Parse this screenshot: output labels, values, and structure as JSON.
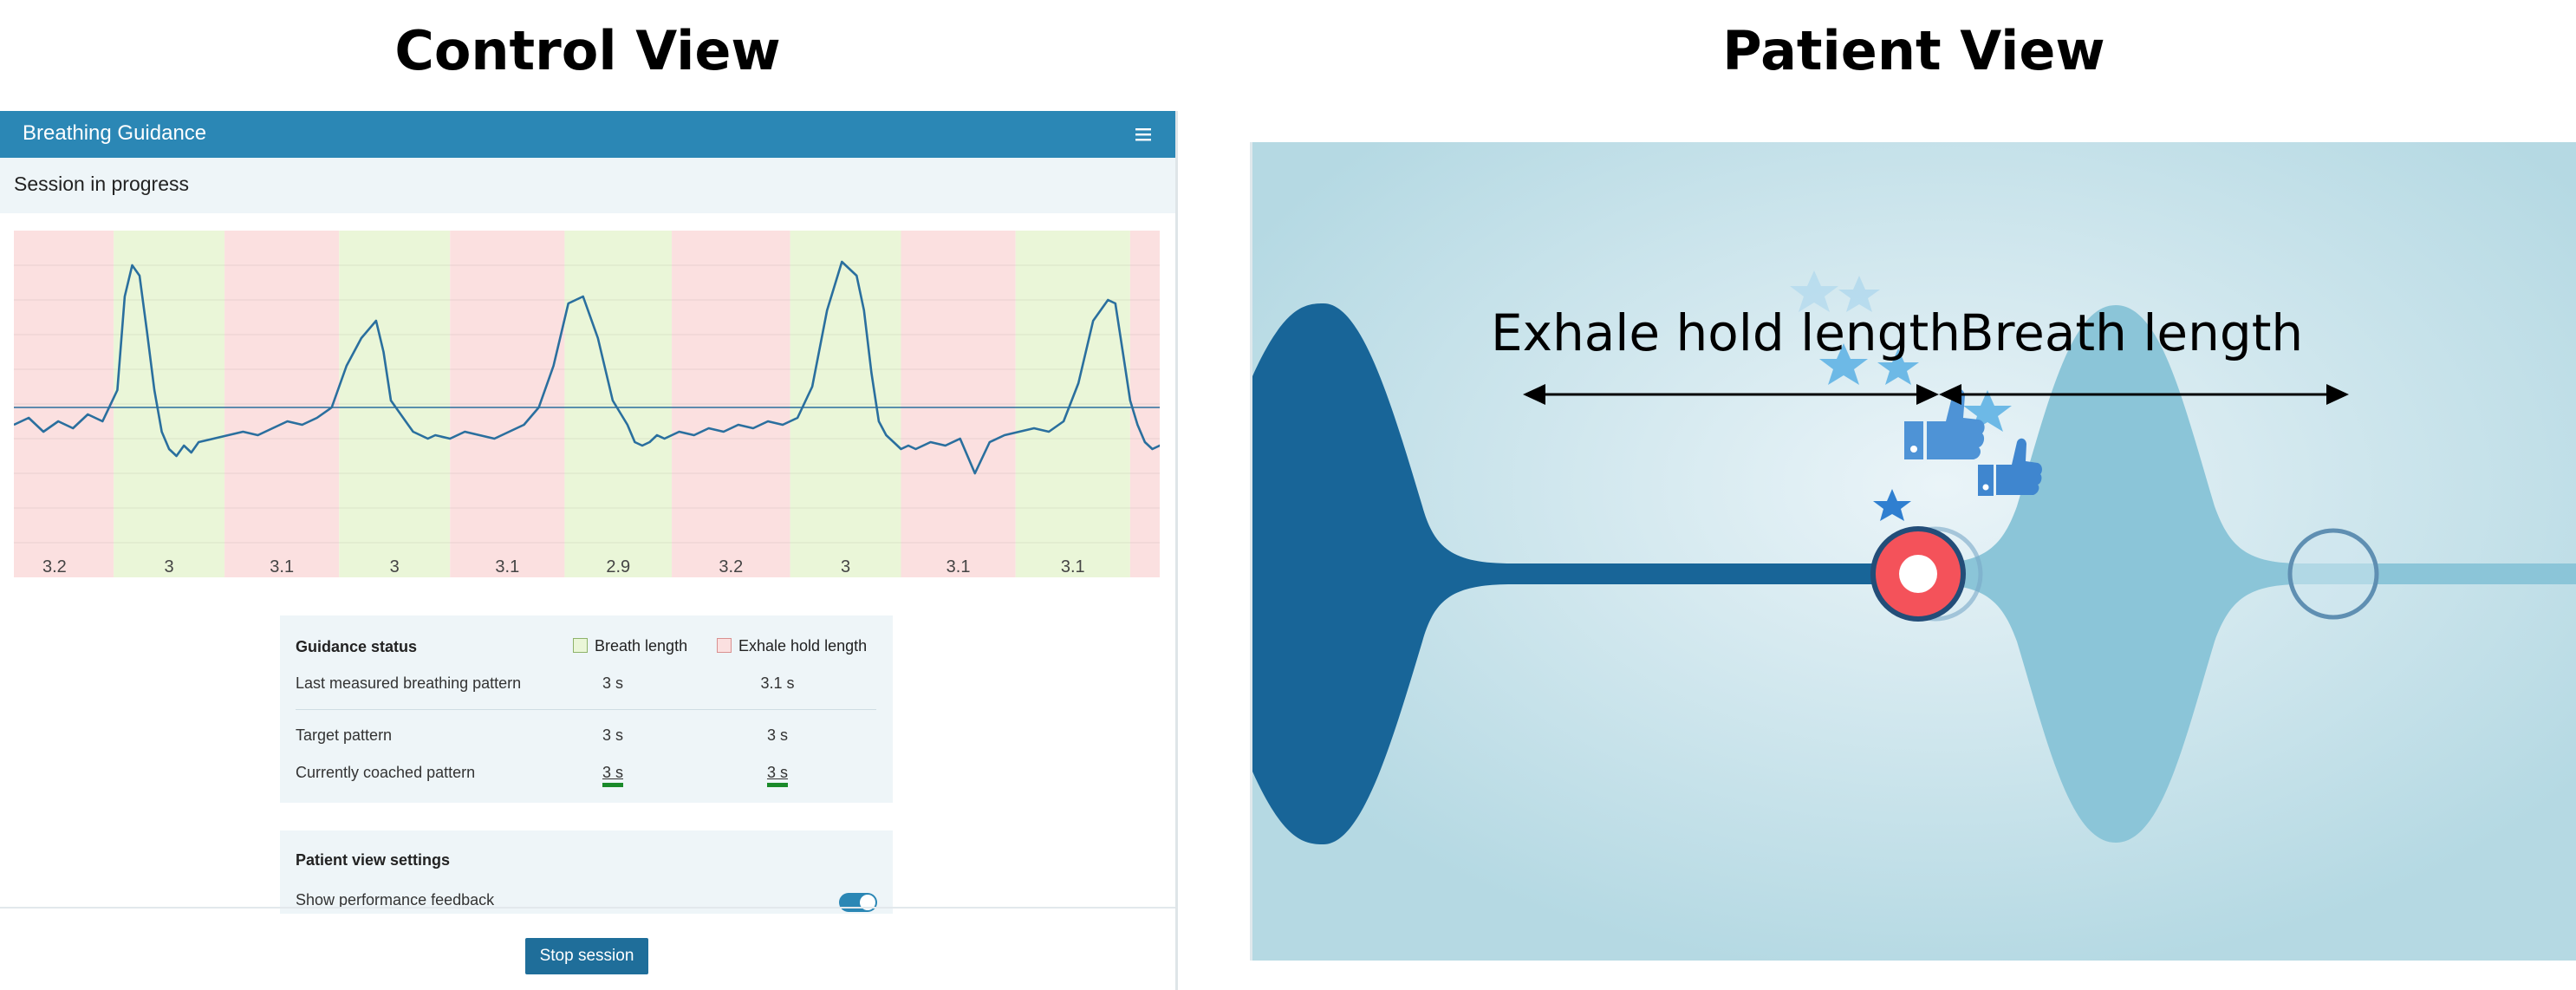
{
  "headings": {
    "control": "Control View",
    "patient": "Patient View"
  },
  "app": {
    "title": "Breathing Guidance",
    "menu_icon": "hamburger-menu-icon",
    "accent_color": "#2b87b5"
  },
  "session": {
    "status": "Session in progress"
  },
  "chart_data": {
    "type": "line",
    "title": "",
    "xlabel": "",
    "ylabel": "",
    "bands": [
      {
        "kind": "exhale_hold",
        "label": "3.2",
        "color": "#fbe0e0"
      },
      {
        "kind": "breath",
        "label": "3",
        "color": "#eaf6d8"
      },
      {
        "kind": "exhale_hold",
        "label": "3.1",
        "color": "#fbe0e0"
      },
      {
        "kind": "breath",
        "label": "3",
        "color": "#eaf6d8"
      },
      {
        "kind": "exhale_hold",
        "label": "3.1",
        "color": "#fbe0e0"
      },
      {
        "kind": "breath",
        "label": "2.9",
        "color": "#eaf6d8"
      },
      {
        "kind": "exhale_hold",
        "label": "3.2",
        "color": "#fbe0e0"
      },
      {
        "kind": "breath",
        "label": "3",
        "color": "#eaf6d8"
      },
      {
        "kind": "exhale_hold",
        "label": "3.1",
        "color": "#fbe0e0"
      },
      {
        "kind": "breath",
        "label": "3.1",
        "color": "#eaf6d8"
      },
      {
        "kind": "exhale_hold",
        "label": "",
        "color": "#fbe0e0"
      }
    ],
    "band_widths_s": [
      3.2,
      3.0,
      3.1,
      3.0,
      3.1,
      2.9,
      3.2,
      3.0,
      3.1,
      3.1,
      0.8
    ],
    "threshold": 0.5,
    "ylim": [
      0,
      1
    ],
    "signal": {
      "name": "",
      "color": "#2a6f9e",
      "t": [
        0,
        0.4,
        0.8,
        1.2,
        1.6,
        2.0,
        2.4,
        2.8,
        3.0,
        3.2,
        3.4,
        3.6,
        3.8,
        4.0,
        4.2,
        4.4,
        4.6,
        4.8,
        5.0,
        5.4,
        5.8,
        6.2,
        6.6,
        7.0,
        7.4,
        7.8,
        8.2,
        8.6,
        9.0,
        9.4,
        9.8,
        10.0,
        10.2,
        10.4,
        10.6,
        10.8,
        11.0,
        11.2,
        11.4,
        11.8,
        12.2,
        12.6,
        13.0,
        13.4,
        13.8,
        14.2,
        14.6,
        15.0,
        15.4,
        15.8,
        16.2,
        16.6,
        16.8,
        17.0,
        17.2,
        17.4,
        17.6,
        17.8,
        18.0,
        18.4,
        18.8,
        19.2,
        19.6,
        20.0,
        20.4,
        20.8,
        21.2,
        21.6,
        22.0,
        22.4,
        22.8,
        23.0,
        23.2,
        23.4,
        23.6,
        23.8,
        24.0,
        24.2,
        24.4,
        24.8,
        25.2,
        25.6,
        26.0,
        26.4,
        26.8,
        27.2,
        27.6,
        28.0,
        28.4,
        28.8,
        29.2,
        29.6,
        29.8,
        30.0,
        30.2,
        30.4,
        30.6,
        30.8,
        31.0,
        31.4,
        31.8,
        32.2,
        32.6,
        32.8
      ],
      "y": [
        0.45,
        0.47,
        0.43,
        0.46,
        0.44,
        0.48,
        0.46,
        0.55,
        0.82,
        0.91,
        0.88,
        0.72,
        0.55,
        0.43,
        0.38,
        0.36,
        0.39,
        0.37,
        0.4,
        0.41,
        0.42,
        0.43,
        0.42,
        0.44,
        0.46,
        0.45,
        0.47,
        0.5,
        0.62,
        0.7,
        0.75,
        0.66,
        0.52,
        0.49,
        0.46,
        0.43,
        0.42,
        0.41,
        0.42,
        0.41,
        0.43,
        0.42,
        0.41,
        0.43,
        0.45,
        0.5,
        0.62,
        0.8,
        0.82,
        0.7,
        0.52,
        0.45,
        0.4,
        0.39,
        0.4,
        0.42,
        0.41,
        0.42,
        0.43,
        0.42,
        0.44,
        0.43,
        0.45,
        0.44,
        0.46,
        0.45,
        0.47,
        0.56,
        0.78,
        0.92,
        0.88,
        0.78,
        0.6,
        0.46,
        0.42,
        0.4,
        0.38,
        0.39,
        0.38,
        0.4,
        0.39,
        0.41,
        0.31,
        0.4,
        0.42,
        0.43,
        0.44,
        0.43,
        0.46,
        0.57,
        0.75,
        0.81,
        0.8,
        0.66,
        0.52,
        0.45,
        0.4,
        0.38,
        0.39,
        0.4,
        0.41,
        0.42,
        0.4,
        0.43
      ]
    },
    "legend": "none",
    "grid": true
  },
  "guidance": {
    "title": "Guidance status",
    "legend": {
      "breath": "Breath length",
      "exhale": "Exhale hold length"
    },
    "rows": [
      {
        "label": "Last measured breathing pattern",
        "breath": "3 s",
        "exhale": "3.1 s"
      },
      {
        "label": "Target pattern",
        "breath": "3 s",
        "exhale": "3 s"
      },
      {
        "label": "Currently coached pattern",
        "breath": "3 s",
        "exhale": "3 s"
      }
    ],
    "coached_underline_color": "#1a8a2a"
  },
  "settings": {
    "title": "Patient view settings",
    "feedback_label": "Show performance feedback",
    "feedback_on": true
  },
  "actions": {
    "stop": "Stop session"
  },
  "patient": {
    "annotations": {
      "exhale": "Exhale hold length",
      "breath": "Breath length"
    },
    "colors": {
      "past": "#186598",
      "future": "#8bc5d8",
      "marker": "#f4525a",
      "background": "#b7dbe5"
    },
    "icons": [
      "thumbs-up-icon",
      "star-icon"
    ]
  }
}
